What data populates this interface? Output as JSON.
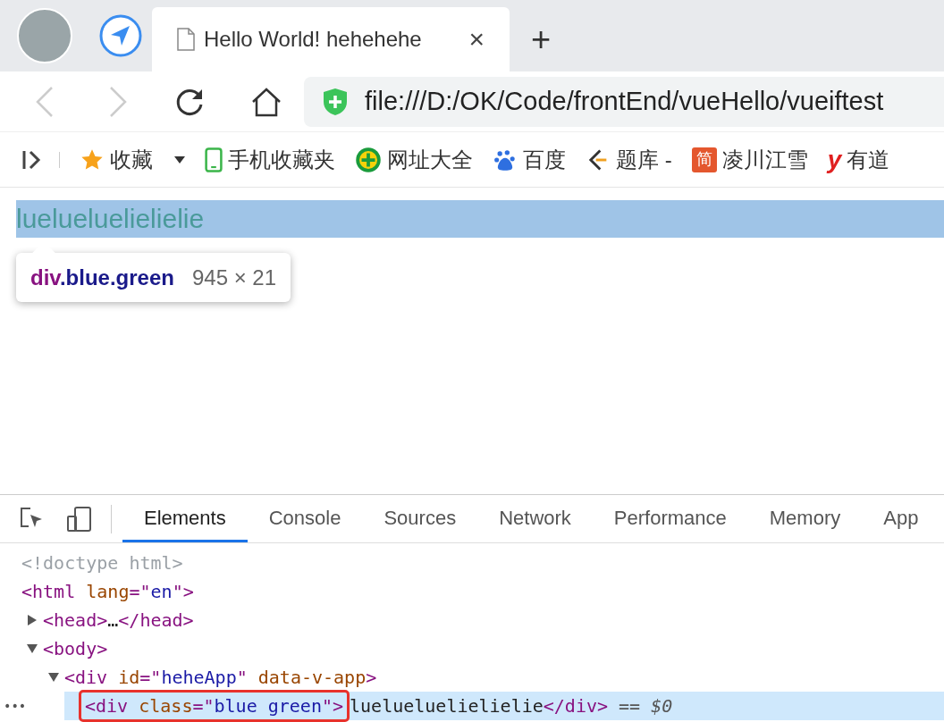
{
  "browser_tab": {
    "title": "Hello World! hehehehe",
    "close": "×",
    "new_tab": "+"
  },
  "address_bar": {
    "url": "file:///D:/OK/Code/frontEnd/vueHello/vueiftest"
  },
  "bookmarks": [
    {
      "kind": "star",
      "label": "收藏",
      "dropdown": true
    },
    {
      "kind": "phone",
      "label": "手机收藏夹",
      "dropdown": false
    },
    {
      "kind": "plus",
      "label": "网址大全",
      "dropdown": false
    },
    {
      "kind": "paw",
      "label": "百度",
      "dropdown": false
    },
    {
      "kind": "bracket",
      "label": "题库 -",
      "dropdown": false
    },
    {
      "kind": "jian",
      "label": "凌川江雪",
      "dropdown": false,
      "icon_text": "简"
    },
    {
      "kind": "y",
      "label": "有道",
      "dropdown": false,
      "icon_text": "y"
    }
  ],
  "page": {
    "text": "luelueluelielielie",
    "tooltip": {
      "tag": "div",
      "classes": ".blue.green",
      "size": "945 × 21"
    }
  },
  "devtools": {
    "tabs": [
      {
        "label": "Elements",
        "selected": true
      },
      {
        "label": "Console",
        "selected": false
      },
      {
        "label": "Sources",
        "selected": false
      },
      {
        "label": "Network",
        "selected": false
      },
      {
        "label": "Performance",
        "selected": false
      },
      {
        "label": "Memory",
        "selected": false
      },
      {
        "label": "App",
        "selected": false
      }
    ],
    "tree": [
      {
        "tokens": [
          {
            "kind": "doctype",
            "text": "<!doctype html>"
          }
        ],
        "selected": false
      },
      {
        "tokens": [
          {
            "kind": "tag",
            "text": "<html"
          },
          {
            "kind": "attr",
            "text": " lang"
          },
          {
            "kind": "punct",
            "text": "=\""
          },
          {
            "kind": "value",
            "text": "en"
          },
          {
            "kind": "punct",
            "text": "\""
          },
          {
            "kind": "tag",
            "text": ">"
          }
        ],
        "selected": false,
        "children": [
          {
            "tokens": [
              {
                "kind": "tag",
                "text": "<head>"
              },
              {
                "kind": "text",
                "text": "…"
              },
              {
                "kind": "tag",
                "text": "</head>"
              }
            ],
            "selected": false,
            "expanded": false
          },
          {
            "tokens": [
              {
                "kind": "tag",
                "text": "<body>"
              }
            ],
            "selected": false,
            "expanded": true,
            "children": [
              {
                "tokens": [
                  {
                    "kind": "tag",
                    "text": "<div"
                  },
                  {
                    "kind": "attr",
                    "text": " id"
                  },
                  {
                    "kind": "punct",
                    "text": "=\""
                  },
                  {
                    "kind": "value",
                    "text": "heheApp"
                  },
                  {
                    "kind": "punct",
                    "text": "\""
                  },
                  {
                    "kind": "attr",
                    "text": " data-v-app"
                  },
                  {
                    "kind": "tag",
                    "text": ">"
                  }
                ],
                "selected": false,
                "expanded": true,
                "children": [
                  {
                    "tokens": [
                      {
                        "kind": "tag",
                        "text": "<div",
                        "outlined": true
                      },
                      {
                        "kind": "attr",
                        "text": " class",
                        "outlined": true
                      },
                      {
                        "kind": "punct",
                        "text": "=\"",
                        "outlined": true
                      },
                      {
                        "kind": "value",
                        "text": "blue green",
                        "outlined": true
                      },
                      {
                        "kind": "punct",
                        "text": "\"",
                        "outlined": true
                      },
                      {
                        "kind": "tag",
                        "text": ">",
                        "outlined": true
                      },
                      {
                        "kind": "text",
                        "text": "luelueluelielielie",
                        "outlined": false
                      },
                      {
                        "kind": "tag",
                        "text": "</div>",
                        "outlined": false
                      },
                      {
                        "kind": "ref",
                        "text": " == $0",
                        "outlined": false
                      }
                    ],
                    "selected": true,
                    "more": "•••"
                  }
                ]
              }
            ]
          }
        ]
      }
    ]
  }
}
